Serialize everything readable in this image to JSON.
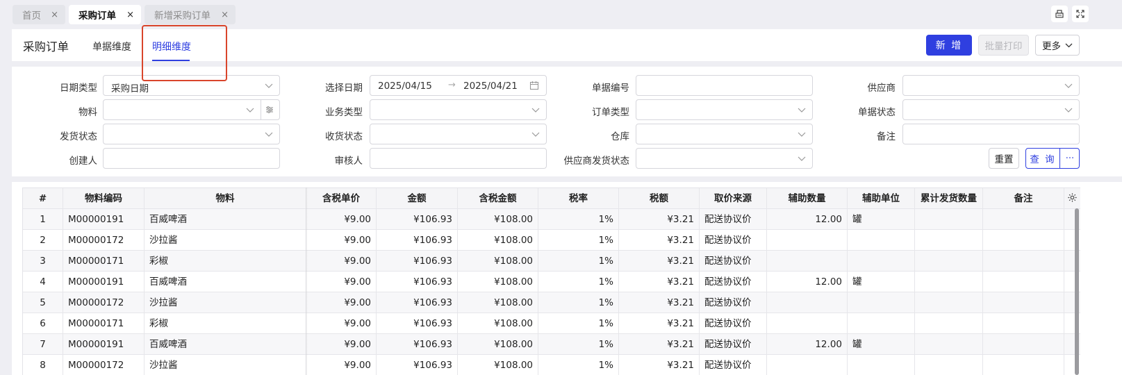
{
  "tabs": [
    {
      "label": "首页",
      "close": "×"
    },
    {
      "label": "采购订单",
      "close": "×"
    },
    {
      "label": "新增采购订单",
      "close": "×"
    }
  ],
  "header": {
    "title": "采购订单",
    "view_tabs": [
      "单据维度",
      "明细维度"
    ],
    "active_view": "明细维度",
    "new_button": "新 增",
    "print_button": "批量打印",
    "more_button": "更多"
  },
  "filters": {
    "date_type_label": "日期类型",
    "date_type_value": "采购日期",
    "select_date_label": "选择日期",
    "date_start": "2025/04/15",
    "date_end": "2025/04/21",
    "date_arrow": "→",
    "doc_no_label": "单据编号",
    "supplier_label": "供应商",
    "material_label": "物料",
    "biz_type_label": "业务类型",
    "order_type_label": "订单类型",
    "doc_status_label": "单据状态",
    "ship_status_label": "发货状态",
    "recv_status_label": "收货状态",
    "warehouse_label": "仓库",
    "remark_label": "备注",
    "creator_label": "创建人",
    "auditor_label": "审核人",
    "supplier_ship_label": "供应商发货状态",
    "reset_button": "重置",
    "query_button": "查 询",
    "query_more": "···"
  },
  "table": {
    "columns": [
      "#",
      "物料编码",
      "物料",
      "含税单价",
      "金额",
      "含税金额",
      "税率",
      "税额",
      "取价来源",
      "辅助数量",
      "辅助单位",
      "累计发货数量",
      "备注"
    ],
    "rows": [
      [
        "1",
        "M00000191",
        "百威啤酒",
        "¥9.00",
        "¥106.93",
        "¥108.00",
        "1%",
        "¥3.21",
        "配送协议价",
        "12.00",
        "罐",
        "",
        ""
      ],
      [
        "2",
        "M00000172",
        "沙拉酱",
        "¥9.00",
        "¥106.93",
        "¥108.00",
        "1%",
        "¥3.21",
        "配送协议价",
        "",
        "",
        "",
        ""
      ],
      [
        "3",
        "M00000171",
        "彩椒",
        "¥9.00",
        "¥106.93",
        "¥108.00",
        "1%",
        "¥3.21",
        "配送协议价",
        "",
        "",
        "",
        ""
      ],
      [
        "4",
        "M00000191",
        "百威啤酒",
        "¥9.00",
        "¥106.93",
        "¥108.00",
        "1%",
        "¥3.21",
        "配送协议价",
        "12.00",
        "罐",
        "",
        ""
      ],
      [
        "5",
        "M00000172",
        "沙拉酱",
        "¥9.00",
        "¥106.93",
        "¥108.00",
        "1%",
        "¥3.21",
        "配送协议价",
        "",
        "",
        "",
        ""
      ],
      [
        "6",
        "M00000171",
        "彩椒",
        "¥9.00",
        "¥106.93",
        "¥108.00",
        "1%",
        "¥3.21",
        "配送协议价",
        "",
        "",
        "",
        ""
      ],
      [
        "7",
        "M00000191",
        "百威啤酒",
        "¥9.00",
        "¥106.93",
        "¥108.00",
        "1%",
        "¥3.21",
        "配送协议价",
        "12.00",
        "罐",
        "",
        ""
      ],
      [
        "8",
        "M00000172",
        "沙拉酱",
        "¥9.00",
        "¥106.93",
        "¥108.00",
        "1%",
        "¥3.21",
        "配送协议价",
        "",
        "",
        "",
        ""
      ]
    ]
  },
  "colors": {
    "accent": "#2f3fe0",
    "highlight": "#d9452b"
  }
}
